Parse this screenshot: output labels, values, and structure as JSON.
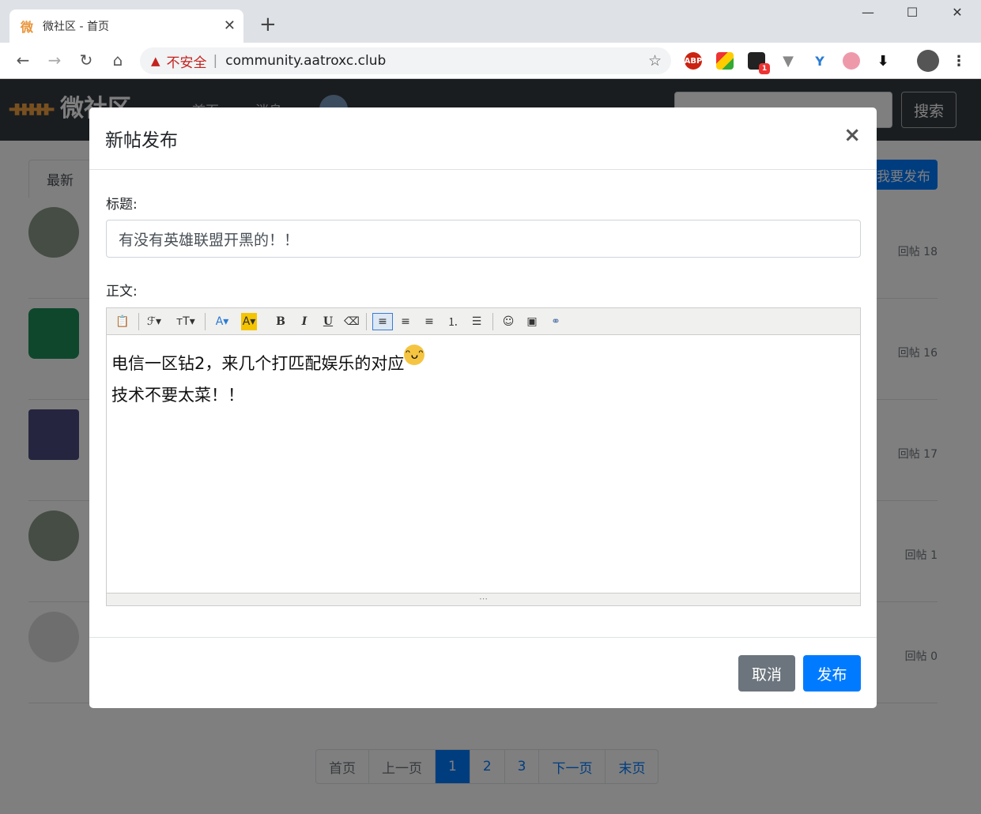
{
  "browser": {
    "tab_title": "微社区 - 首页",
    "tab_favicon": "微",
    "insecure_label": "不安全",
    "url": "community.aatroxc.club",
    "ext_badge": "1"
  },
  "site": {
    "logo": "微社区",
    "nav_links": [
      "首页",
      "消息"
    ],
    "search_button": "搜索",
    "tab_latest": "最新",
    "post_button": "我要发布",
    "posts": [
      {
        "replies": "回帖 18"
      },
      {
        "replies": "回帖 16"
      },
      {
        "replies": "回帖 17"
      },
      {
        "replies": "回帖 1"
      },
      {
        "replies": "回帖 0"
      }
    ],
    "pagination": [
      "首页",
      "上一页",
      "1",
      "2",
      "3",
      "下一页",
      "末页"
    ]
  },
  "modal": {
    "title": "新帖发布",
    "close": "×",
    "title_label": "标题:",
    "title_value": "有没有英雄联盟开黑的！！",
    "body_label": "正文:",
    "body_line1": "电信一区钻2，来几个打匹配娱乐的对应",
    "body_line2": "技术不要太菜！！",
    "cancel": "取消",
    "submit": "发布"
  },
  "colors": {
    "primary": "#007bff",
    "secondary": "#6c757d",
    "navbar": "#343a40"
  }
}
